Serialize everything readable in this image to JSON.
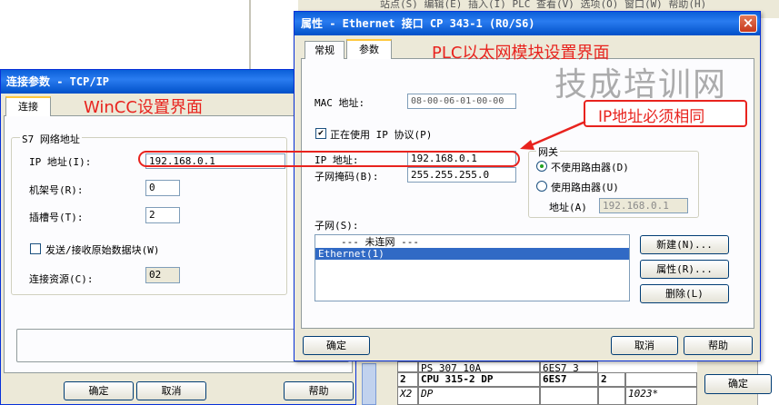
{
  "bg_window": {
    "menu_fragment": "站点(S)  编辑(E)  插入(I)  PLC  查看(V)  选项(O)  窗口(W)  帮助(H)",
    "hw_rows": [
      {
        "num": "",
        "module": "PS 307 10A",
        "order": "6ES7 3"
      },
      {
        "num": "2",
        "module": "CPU 315-2 DP",
        "order": "6ES7",
        "fw": "2"
      },
      {
        "num": "X2",
        "module": "DP",
        "order": "",
        "fw": "",
        "addr": "1023*"
      }
    ],
    "ok_label": "确定"
  },
  "wincc_dialog": {
    "title": "连接参数 - TCP/IP",
    "tab_connect": "连接",
    "annotation": "WinCC设置界面",
    "group_title": "S7 网络地址",
    "ip_label": "IP 地址(I):",
    "ip_value": "192.168.0.1",
    "rack_label": "机架号(R):",
    "rack_value": "0",
    "slot_label": "插槽号(T):",
    "slot_value": "2",
    "raw_label": "发送/接收原始数据块(W)",
    "resource_label": "连接资源(C):",
    "resource_value": "02",
    "ok_label": "确定",
    "cancel_label": "取消",
    "help_label": "帮助"
  },
  "plc_dialog": {
    "title": "属性 - Ethernet 接口  CP 343-1 (R0/S6)",
    "tab_general": "常规",
    "tab_params": "参数",
    "annotation": "PLC以太网模块设置界面",
    "mac_label": "MAC 地址:",
    "mac_value": "08-00-06-01-00-00",
    "use_ip_label": "正在使用 IP 协议(P)",
    "ip_label": "IP 地址:",
    "ip_value": "192.168.0.1",
    "mask_label": "子网掩码(B):",
    "mask_value": "255.255.255.0",
    "gateway_title": "网关",
    "no_router_label": "不使用路由器(D)",
    "use_router_label": "使用路由器(U)",
    "addr_label": "地址(A)",
    "addr_value": "192.168.0.1",
    "subnet_label": "子网(S):",
    "subnet_items": [
      "--- 未连网 ---",
      "Ethernet(1)"
    ],
    "new_label": "新建(N)...",
    "props_label": "属性(R)...",
    "delete_label": "删除(L)",
    "ok_label": "确定",
    "cancel_label": "取消",
    "help_label": "帮助",
    "close_glyph": "×"
  },
  "callout": "IP地址必须相同",
  "watermark": "技成培训网",
  "colors": {
    "annotation_red": "#e8231e",
    "selection": "#316ac5",
    "title_blue": "#0a5fd8"
  }
}
